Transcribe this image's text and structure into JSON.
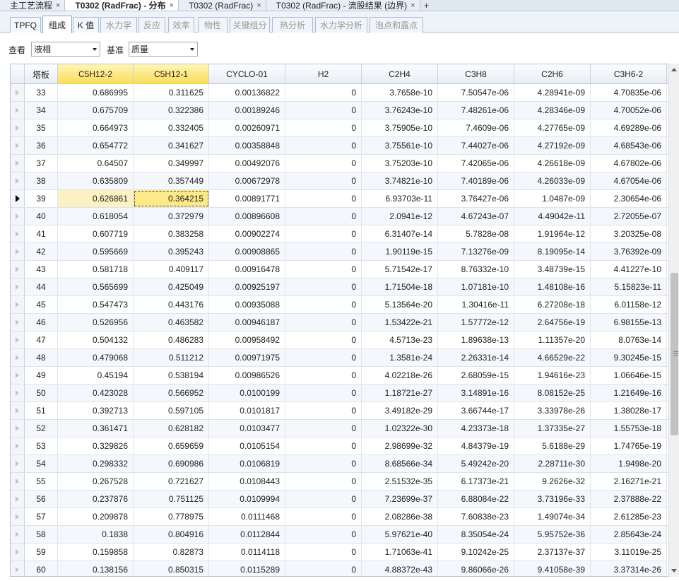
{
  "document_tabs": [
    {
      "label": "主工艺流程",
      "active": false
    },
    {
      "label": "T0302 (RadFrac) - 分布",
      "active": true
    },
    {
      "label": "T0302 (RadFrac)",
      "active": false
    },
    {
      "label": "T0302 (RadFrac) - 流股结果 (边界)",
      "active": false
    }
  ],
  "add_tab_icon": "+",
  "close_icon": "×",
  "view_tabs": [
    {
      "label": "TPFQ",
      "state": "normal"
    },
    {
      "label": "组成",
      "state": "active"
    },
    {
      "label": "K 值",
      "state": "normal"
    },
    {
      "label": "水力学",
      "state": "disabled"
    },
    {
      "label": "反应",
      "state": "disabled"
    },
    {
      "label": "效率",
      "state": "disabled"
    },
    {
      "label": "物性",
      "state": "disabled"
    },
    {
      "label": "关键组分",
      "state": "disabled"
    },
    {
      "label": "热分析",
      "state": "disabled"
    },
    {
      "label": "水力学分析",
      "state": "disabled"
    },
    {
      "label": "泡点和露点",
      "state": "disabled"
    }
  ],
  "toolbar": {
    "view_label": "查看",
    "view_value": "液相",
    "basis_label": "基准",
    "basis_value": "质量"
  },
  "grid": {
    "columns": [
      "塔板",
      "C5H12-2",
      "C5H12-1",
      "CYCLO-01",
      "H2",
      "C2H4",
      "C3H8",
      "C2H6",
      "C3H6-2"
    ],
    "highlighted_columns": [
      "C5H12-2",
      "C5H12-1"
    ],
    "selected_stage": "39",
    "rows": [
      [
        "33",
        "0.686995",
        "0.311625",
        "0.00136822",
        "0",
        "3.7658e-10",
        "7.50547e-06",
        "4.28941e-09",
        "4.70835e-06"
      ],
      [
        "34",
        "0.675709",
        "0.322386",
        "0.00189246",
        "0",
        "3.76243e-10",
        "7.48261e-06",
        "4.28346e-09",
        "4.70052e-06"
      ],
      [
        "35",
        "0.664973",
        "0.332405",
        "0.00260971",
        "0",
        "3.75905e-10",
        "7.4609e-06",
        "4.27765e-09",
        "4.69289e-06"
      ],
      [
        "36",
        "0.654772",
        "0.341627",
        "0.00358848",
        "0",
        "3.75561e-10",
        "7.44027e-06",
        "4.27192e-09",
        "4.68543e-06"
      ],
      [
        "37",
        "0.64507",
        "0.349997",
        "0.00492076",
        "0",
        "3.75203e-10",
        "7.42065e-06",
        "4.26618e-09",
        "4.67802e-06"
      ],
      [
        "38",
        "0.635809",
        "0.357449",
        "0.00672978",
        "0",
        "3.74821e-10",
        "7.40189e-06",
        "4.26033e-09",
        "4.67054e-06"
      ],
      [
        "39",
        "0.626861",
        "0.364215",
        "0.00891771",
        "0",
        "6.93703e-11",
        "3.76427e-06",
        "1.0487e-09",
        "2.30654e-06"
      ],
      [
        "40",
        "0.618054",
        "0.372979",
        "0.00896608",
        "0",
        "2.0941e-12",
        "4.67243e-07",
        "4.49042e-11",
        "2.72055e-07"
      ],
      [
        "41",
        "0.607719",
        "0.383258",
        "0.00902274",
        "0",
        "6.31407e-14",
        "5.7828e-08",
        "1.91964e-12",
        "3.20325e-08"
      ],
      [
        "42",
        "0.595669",
        "0.395243",
        "0.00908865",
        "0",
        "1.90119e-15",
        "7.13276e-09",
        "8.19095e-14",
        "3.76392e-09"
      ],
      [
        "43",
        "0.581718",
        "0.409117",
        "0.00916478",
        "0",
        "5.71542e-17",
        "8.76332e-10",
        "3.48739e-15",
        "4.41227e-10"
      ],
      [
        "44",
        "0.565699",
        "0.425049",
        "0.00925197",
        "0",
        "1.71504e-18",
        "1.07181e-10",
        "1.48108e-16",
        "5.15823e-11"
      ],
      [
        "45",
        "0.547473",
        "0.443176",
        "0.00935088",
        "0",
        "5.13564e-20",
        "1.30416e-11",
        "6.27208e-18",
        "6.01158e-12"
      ],
      [
        "46",
        "0.526956",
        "0.463582",
        "0.00946187",
        "0",
        "1.53422e-21",
        "1.57772e-12",
        "2.64756e-19",
        "6.98155e-13"
      ],
      [
        "47",
        "0.504132",
        "0.486283",
        "0.00958492",
        "0",
        "4.5713e-23",
        "1.89638e-13",
        "1.11357e-20",
        "8.0763e-14"
      ],
      [
        "48",
        "0.479068",
        "0.511212",
        "0.00971975",
        "0",
        "1.3581e-24",
        "2.26331e-14",
        "4.66529e-22",
        "9.30245e-15"
      ],
      [
        "49",
        "0.45194",
        "0.538194",
        "0.00986526",
        "0",
        "4.02218e-26",
        "2.68059e-15",
        "1.94616e-23",
        "1.06646e-15"
      ],
      [
        "50",
        "0.423028",
        "0.566952",
        "0.0100199",
        "0",
        "1.18721e-27",
        "3.14891e-16",
        "8.08152e-25",
        "1.21649e-16"
      ],
      [
        "51",
        "0.392713",
        "0.597105",
        "0.0101817",
        "0",
        "3.49182e-29",
        "3.66744e-17",
        "3.33978e-26",
        "1.38028e-17"
      ],
      [
        "52",
        "0.361471",
        "0.628182",
        "0.0103477",
        "0",
        "1.02322e-30",
        "4.23373e-18",
        "1.37335e-27",
        "1.55753e-18"
      ],
      [
        "53",
        "0.329826",
        "0.659659",
        "0.0105154",
        "0",
        "2.98699e-32",
        "4.84379e-19",
        "5.6188e-29",
        "1.74765e-19"
      ],
      [
        "54",
        "0.298332",
        "0.690986",
        "0.0106819",
        "0",
        "8.68566e-34",
        "5.49242e-20",
        "2.28711e-30",
        "1.9498e-20"
      ],
      [
        "55",
        "0.267528",
        "0.721627",
        "0.0108443",
        "0",
        "2.51532e-35",
        "6.17373e-21",
        "9.2626e-32",
        "2.16271e-21"
      ],
      [
        "56",
        "0.237876",
        "0.751125",
        "0.0109994",
        "0",
        "7.23699e-37",
        "6.88084e-22",
        "3.73196e-33",
        "2.37888e-22"
      ],
      [
        "57",
        "0.209878",
        "0.778975",
        "0.0111468",
        "0",
        "2.08286e-38",
        "7.60838e-23",
        "1.49074e-34",
        "2.61285e-23"
      ],
      [
        "58",
        "0.1838",
        "0.804916",
        "0.0112844",
        "0",
        "5.97621e-40",
        "8.35054e-24",
        "5.95752e-36",
        "2.85643e-24"
      ],
      [
        "59",
        "0.159858",
        "0.82873",
        "0.0114118",
        "0",
        "1.71063e-41",
        "9.10242e-25",
        "2.37137e-37",
        "3.11019e-25"
      ],
      [
        "60",
        "0.138156",
        "0.850315",
        "0.0115289",
        "0",
        "4.88372e-43",
        "9.86066e-26",
        "9.41058e-39",
        "3.37314e-26"
      ]
    ]
  }
}
